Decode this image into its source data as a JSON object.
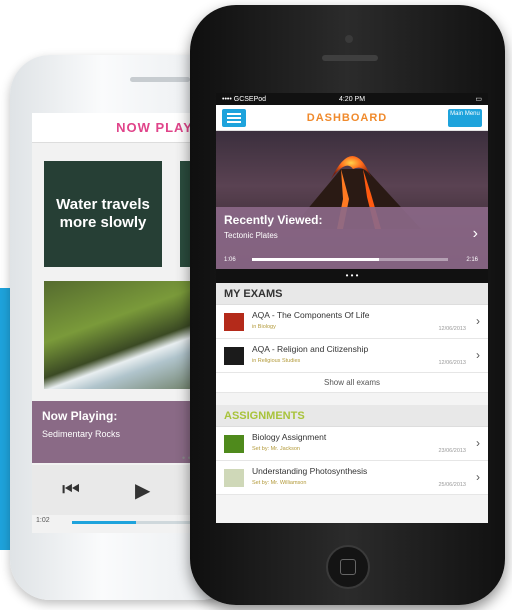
{
  "white_phone": {
    "header_title": "NOW PLAY",
    "card_text": "Water travels more slowly",
    "now_playing_label": "Now Playing:",
    "now_playing_track": "Sedimentary Rocks",
    "dots": "• •",
    "time_elapsed": "1:02"
  },
  "dashboard": {
    "status": {
      "carrier": "•••• GCSEPod",
      "clock": "4:20 PM",
      "battery": "▭"
    },
    "title": "DASHBOARD",
    "main_menu_label": "Main Menu",
    "recently_viewed_label": "Recently Viewed:",
    "recently_viewed_item": "Tectonic Plates",
    "time_elapsed": "1:06",
    "time_total": "2:16",
    "carousel_dots": "• • •",
    "exams_heading": "MY EXAMS",
    "exams": [
      {
        "title": "AQA - The Components Of Life",
        "subject": "in Biology",
        "date": "12/06/2013"
      },
      {
        "title": "AQA - Religion and Citizenship",
        "subject": "in Religious Studies",
        "date": "12/06/2013"
      }
    ],
    "show_all_exams": "Show all exams",
    "assignments_heading": "ASSIGNMENTS",
    "assignments": [
      {
        "title": "Biology Assignment",
        "subject": "Set by: Mr. Jackson",
        "date": "23/06/2013"
      },
      {
        "title": "Understanding Photosynthesis",
        "subject": "Set by: Mr. Williamson",
        "date": "25/06/2013"
      }
    ]
  },
  "colors": {
    "accent_blue": "#1ea3dc",
    "title_orange": "#f08a2c",
    "assignments_green": "#a8c33a",
    "overlay_purple": "#8b6888",
    "now_playing_pink": "#e0448a"
  },
  "icons": [
    "menu-icon",
    "chevron-right-icon",
    "previous-track-icon",
    "play-icon"
  ]
}
